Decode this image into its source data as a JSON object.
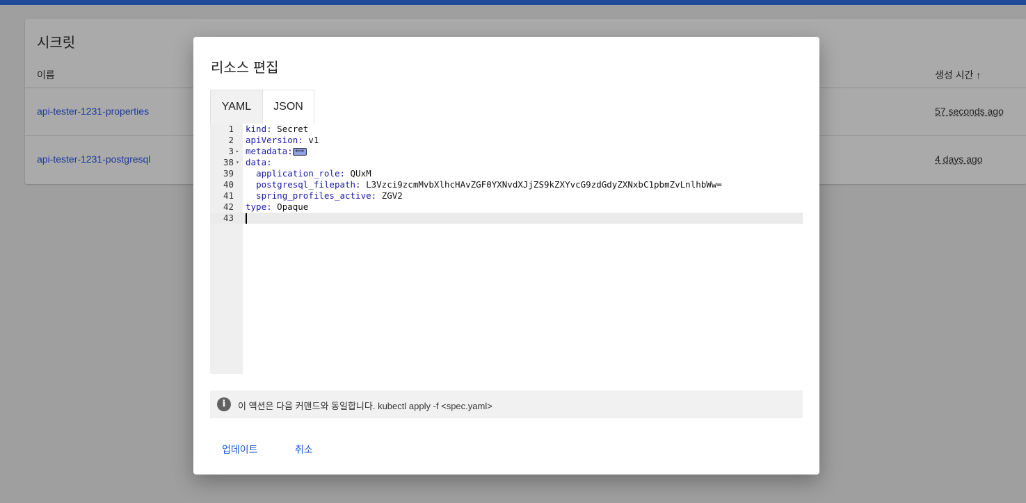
{
  "page": {
    "title": "시크릿",
    "columns": {
      "name": "이름",
      "created": "생성 시간",
      "sort_icon": "↑"
    },
    "rows": [
      {
        "name": "api-tester-1231-properties",
        "created": "57 seconds ago"
      },
      {
        "name": "api-tester-1231-postgresql",
        "created": "4 days ago"
      }
    ]
  },
  "dialog": {
    "title": "리소스 편집",
    "tabs": [
      {
        "label": "YAML"
      },
      {
        "label": "JSON"
      }
    ],
    "editor": {
      "lines": [
        {
          "n": "1",
          "key": "kind:",
          "val": " Secret",
          "indent": ""
        },
        {
          "n": "2",
          "key": "apiVersion:",
          "val": " v1",
          "indent": ""
        },
        {
          "n": "3",
          "key": "metadata:",
          "val": "",
          "indent": "",
          "fold": "▸",
          "collapsed": true,
          "collapsed_marker": "⟺"
        },
        {
          "n": "38",
          "key": "data:",
          "val": "",
          "indent": "",
          "fold": "▾"
        },
        {
          "n": "39",
          "key": "application_role:",
          "val": " QUxM",
          "indent": "  "
        },
        {
          "n": "40",
          "key": "postgresql_filepath:",
          "val": " L3Vzci9zcmMvbXlhcHAvZGF0YXNvdXJjZS9kZXYvcG9zdGdyZXNxbC1pbmZvLnlhbWw=",
          "indent": "  "
        },
        {
          "n": "41",
          "key": "spring_profiles_active:",
          "val": " ZGV2",
          "indent": "  "
        },
        {
          "n": "42",
          "key": "type:",
          "val": " Opaque",
          "indent": ""
        },
        {
          "n": "43",
          "key": "",
          "val": "",
          "indent": "",
          "active": true
        }
      ]
    },
    "info": "이 액션은 다음 커맨드와 동일합니다. kubectl apply -f <spec.yaml>",
    "update_label": "업데이트",
    "cancel_label": "취소"
  }
}
